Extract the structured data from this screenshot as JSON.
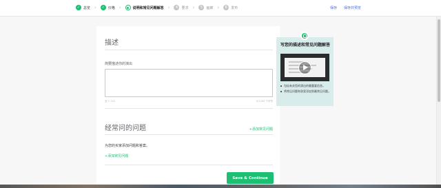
{
  "steps": [
    {
      "label": "总览",
      "status": "done",
      "mark": "✓"
    },
    {
      "label": "价格",
      "status": "done",
      "mark": "✓"
    },
    {
      "label": "说明和常见问题解答",
      "status": "current",
      "mark": ""
    },
    {
      "label": "要求",
      "status": "todo",
      "mark": "4"
    },
    {
      "label": "画廊",
      "status": "todo",
      "mark": "5"
    },
    {
      "label": "发布",
      "status": "todo",
      "mark": "6"
    }
  ],
  "nav": {
    "save_label": "保存",
    "preview_label": "保存并预览"
  },
  "description": {
    "title": "描述",
    "field_label": "简要描述你的演出",
    "textarea_value": "",
    "hint_left": "至少 120",
    "hint_right": "0/1200 个字符"
  },
  "faq": {
    "title": "经常问的问题",
    "add_link": "+添加常见问题",
    "description": "为您的买家添加问题和答案。",
    "add_sub_link": "+添加常见问题"
  },
  "tip": {
    "title": "写您的描述和常见问题解答",
    "bullets": [
      "包括有关您的演出的最重要信息。",
      "将常见问题和答案添加到最常见问题。"
    ]
  },
  "footer": {
    "save_continue": "Save & Continue"
  },
  "colors": {
    "accent": "#1dbf73",
    "link": "#446ee7",
    "tip_bg": "#d9ecec"
  },
  "icons": {
    "done": "check-icon",
    "bulb": "lightbulb-icon",
    "play": "play-icon"
  }
}
